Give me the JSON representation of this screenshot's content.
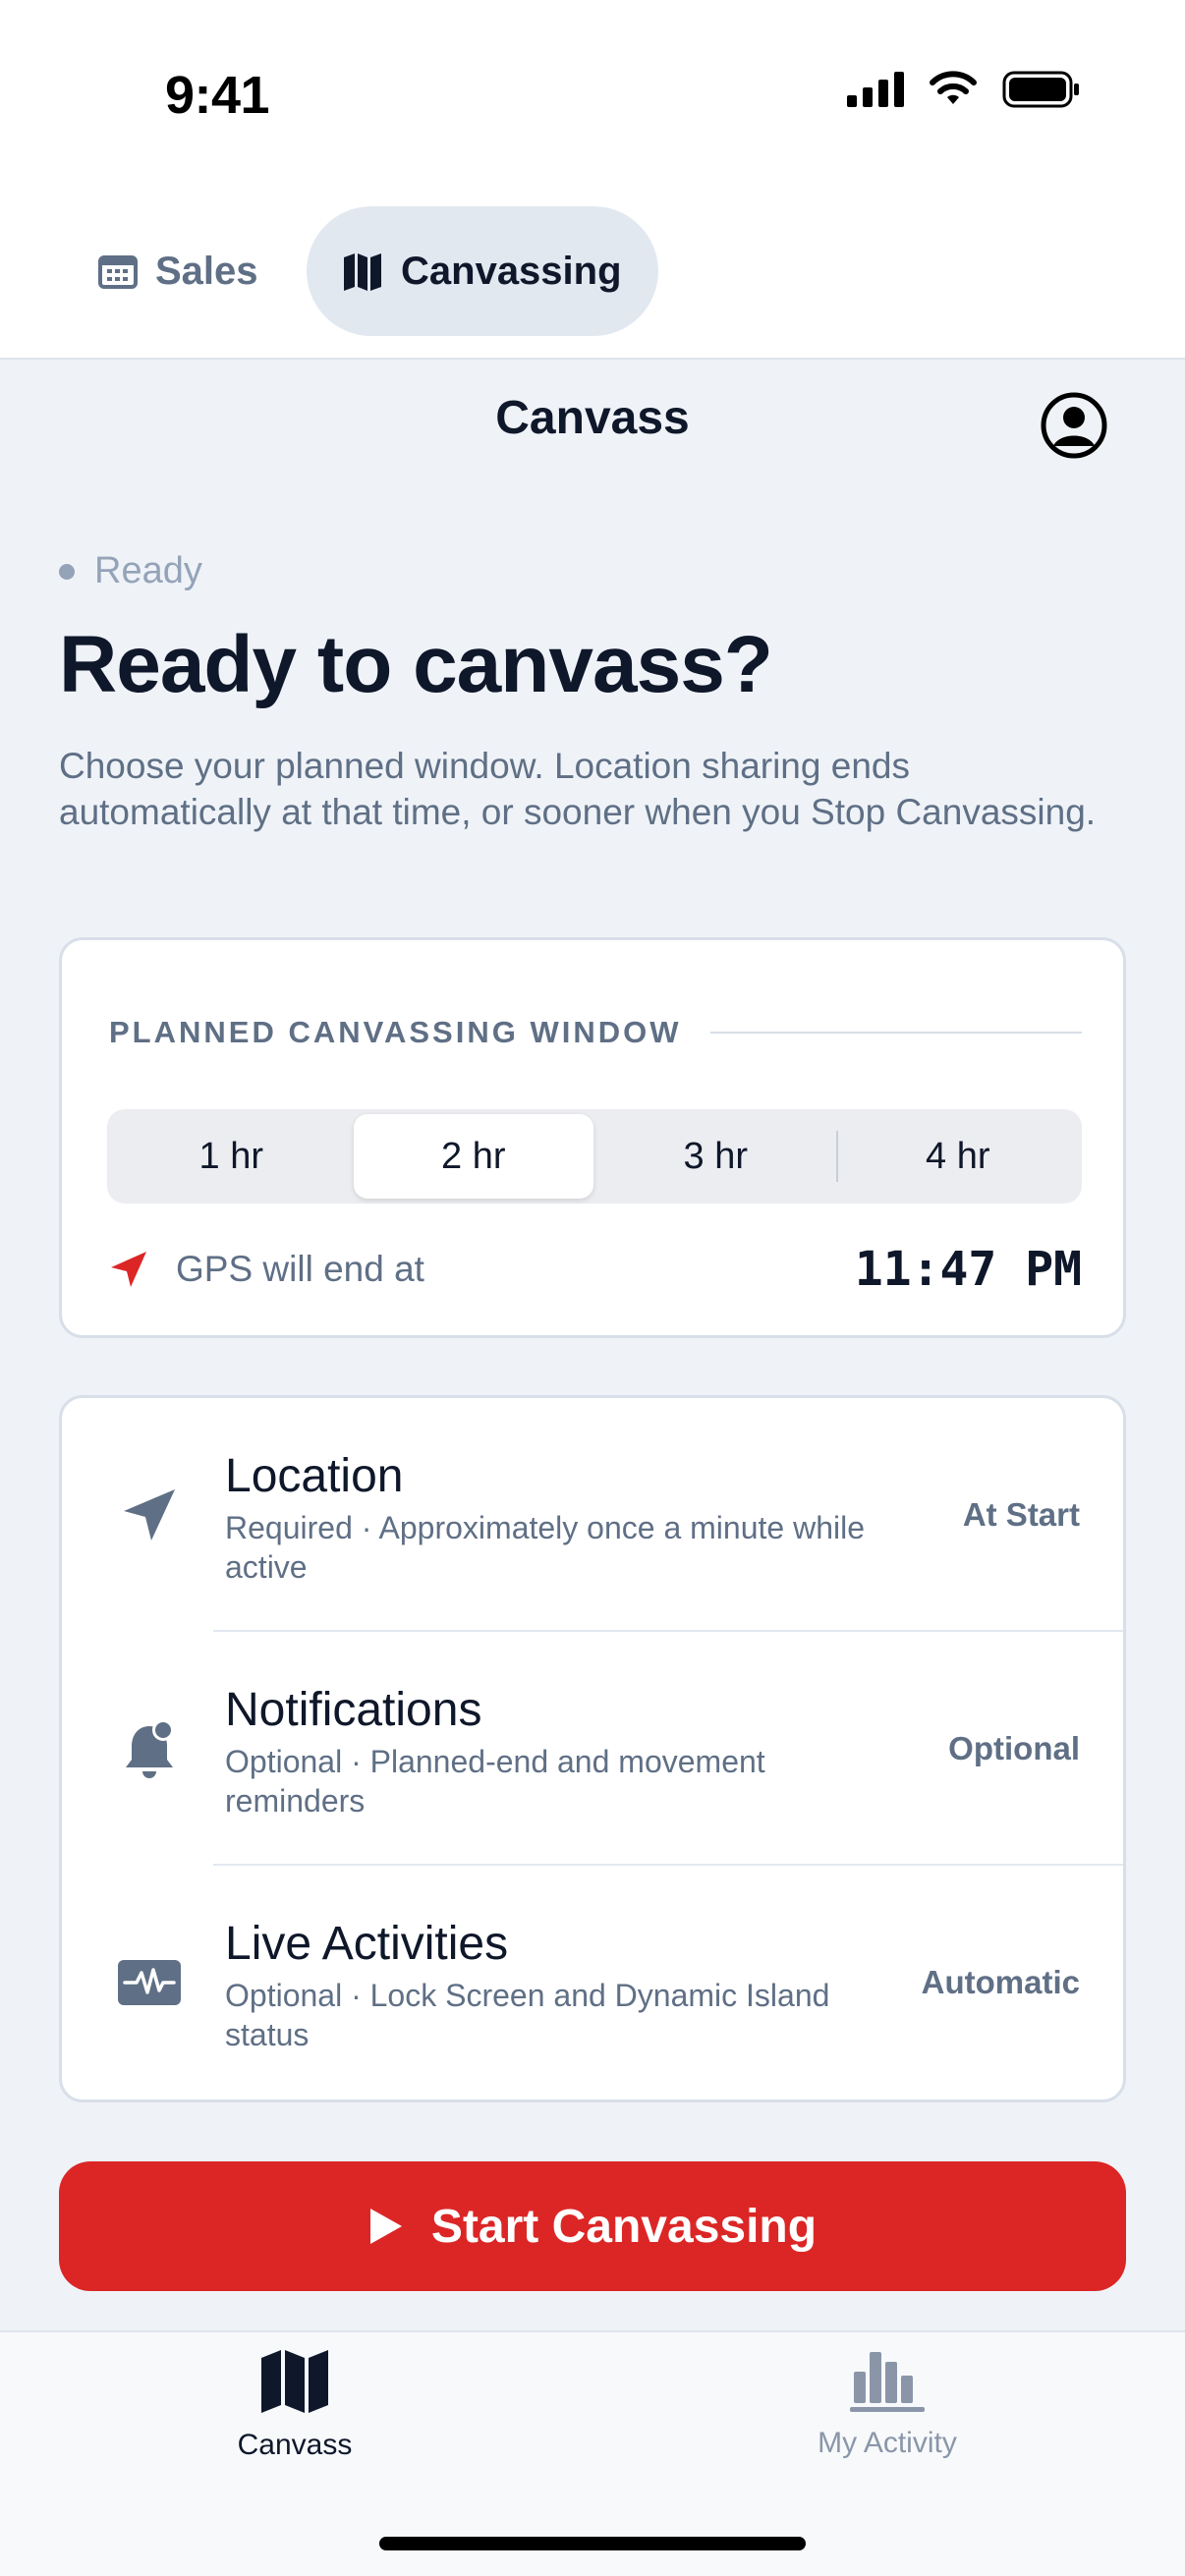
{
  "status_bar": {
    "time": "9:41",
    "icons": [
      "cellular-signal-icon",
      "wifi-icon",
      "battery-icon"
    ]
  },
  "mode_tabs": [
    {
      "label": "Sales",
      "icon": "calendar-icon",
      "selected": false
    },
    {
      "label": "Canvassing",
      "icon": "map-icon",
      "selected": true
    }
  ],
  "nav": {
    "title": "Canvass",
    "profile_icon": "person-circle-icon"
  },
  "intro": {
    "status": "Ready",
    "headline": "Ready to canvass?",
    "description": "Choose your planned window. Location sharing ends automatically at that time, or sooner when you Stop Canvassing."
  },
  "window_card": {
    "section_label": "PLANNED CANVASSING WINDOW",
    "options": [
      "1 hr",
      "2 hr",
      "3 hr",
      "4 hr"
    ],
    "selected_option": "2 hr",
    "gps_label": "GPS will end at",
    "gps_end_time": "11:47 PM"
  },
  "permissions": [
    {
      "title": "Location",
      "subtitle": "Required · Approximately once a minute while active",
      "status": "At Start",
      "icon": "location-arrow-icon"
    },
    {
      "title": "Notifications",
      "subtitle": "Optional · Planned-end and movement reminders",
      "status": "Optional",
      "icon": "bell-badge-icon"
    },
    {
      "title": "Live Activities",
      "subtitle": "Optional · Lock Screen and Dynamic Island status",
      "status": "Automatic",
      "icon": "waveform-card-icon"
    }
  ],
  "start_button": {
    "label": "Start Canvassing",
    "icon": "play-icon"
  },
  "tab_bar": [
    {
      "label": "Canvass",
      "icon": "map-icon",
      "active": true
    },
    {
      "label": "My Activity",
      "icon": "bar-chart-icon",
      "active": false
    }
  ],
  "colors": {
    "accent_red": "#dc2626",
    "text_primary": "#0f172a",
    "text_secondary": "#5f6f85",
    "background": "#eff3f8"
  }
}
